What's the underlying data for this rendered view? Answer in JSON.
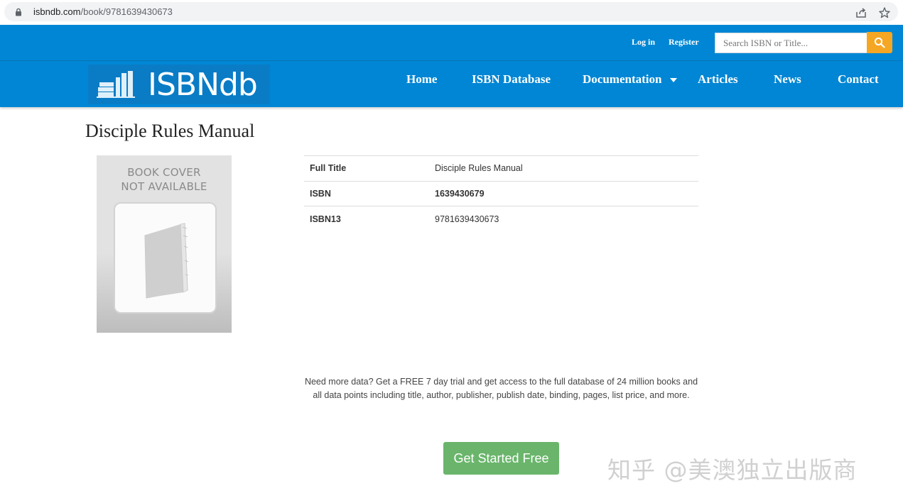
{
  "browser": {
    "url_host": "isbndb.com",
    "url_path": "/book/9781639430673"
  },
  "header": {
    "login_label": "Log in",
    "register_label": "Register",
    "search_placeholder": "Search ISBN or Title...",
    "brand_name": "ISBNdb"
  },
  "nav": {
    "items": [
      {
        "label": "Home"
      },
      {
        "label": "ISBN Database"
      },
      {
        "label": "Documentation"
      },
      {
        "label": "Articles"
      },
      {
        "label": "News"
      },
      {
        "label": "Contact"
      }
    ]
  },
  "book": {
    "page_title": "Disciple Rules Manual",
    "cover_line1": "BOOK COVER",
    "cover_line2": "NOT AVAILABLE",
    "details": [
      {
        "label": "Full Title",
        "value": "Disciple Rules Manual"
      },
      {
        "label": "ISBN",
        "value": "1639430679"
      },
      {
        "label": "ISBN13",
        "value": "9781639430673"
      }
    ]
  },
  "promo": {
    "text": "Need more data? Get a FREE 7 day trial and get access to the full database of 24 million books and all data points including title, author, publisher, publish date, binding, pages, list price, and more.",
    "cta_label": "Get Started Free"
  },
  "watermark": {
    "text": "知乎 @美澳独立出版商"
  },
  "colors": {
    "brand_blue": "#0086d4",
    "search_orange": "#f5a623",
    "cta_green": "#6ab56b"
  }
}
